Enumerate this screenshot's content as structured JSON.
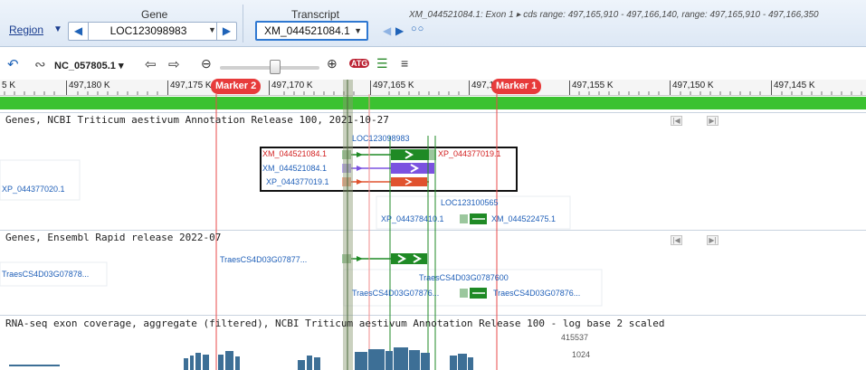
{
  "nav": {
    "region_label": "Region",
    "gene_label": "Gene",
    "gene_value": "LOC123098983",
    "transcript_label": "Transcript",
    "transcript_value": "XM_044521084.1",
    "transcript_info": "XM_044521084.1: Exon 1 ▸ cds range: 497,165,910 - 497,166,140, range: 497,165,910 - 497,166,350"
  },
  "toolbar": {
    "sequence": "NC_057805.1",
    "icons": [
      "back-icon",
      "forward-link-icon",
      "sequence-dropdown",
      "pan-left-icon",
      "pan-right-icon",
      "zoom-out-icon",
      "zoom-slider",
      "zoom-in-icon",
      "atg-icon",
      "tracks-icon",
      "compress-icon"
    ]
  },
  "ruler": {
    "ticks": [
      "5 K",
      "497,180 K",
      "497,175 K",
      "497,170 K",
      "497,165 K",
      "497,160 K",
      "497,155 K",
      "497,150 K",
      "497,145 K"
    ],
    "marker2": "Marker 2",
    "marker1": "Marker 1"
  },
  "tracks": [
    {
      "title": "Genes, NCBI Triticum aestivum Annotation Release 100, 2021-10-27"
    },
    {
      "title": "Genes, Ensembl Rapid release 2022-07"
    },
    {
      "title": "RNA-seq exon coverage, aggregate (filtered), NCBI Triticum aestivum Annotation Release 100 - log base 2 scaled"
    }
  ],
  "features": {
    "gene1": "LOC123098983",
    "rna1": "XM_044521084.1",
    "prot1": "XP_044377019.1",
    "rna2": "XM_044521084.1",
    "prot2": "XP_044377019.1",
    "left_prot": "XP_044377020.1",
    "gene2": "LOC123100565",
    "prot3": "XP_044378410.1",
    "rna3": "XM_044522475.1",
    "ens1": "TraesCS4D03G07877...",
    "ens_left": "TraesCS4D03G07878...",
    "ens2": "TraesCS4D03G0787600",
    "ens3": "TraesCS4D03G07876...",
    "ens4": "TraesCS4D03G07876..."
  },
  "coverage": {
    "max_label": "415537",
    "mid_label": "1024"
  },
  "colors": {
    "nav_bg": "#dde8f5",
    "marker": "#e73b3b",
    "green_band": "#3bc230",
    "gene_green": "#1f8a25",
    "mrna_purple": "#7b52e0",
    "protein_red": "#e0522e",
    "coverage": "#3d6f96"
  }
}
